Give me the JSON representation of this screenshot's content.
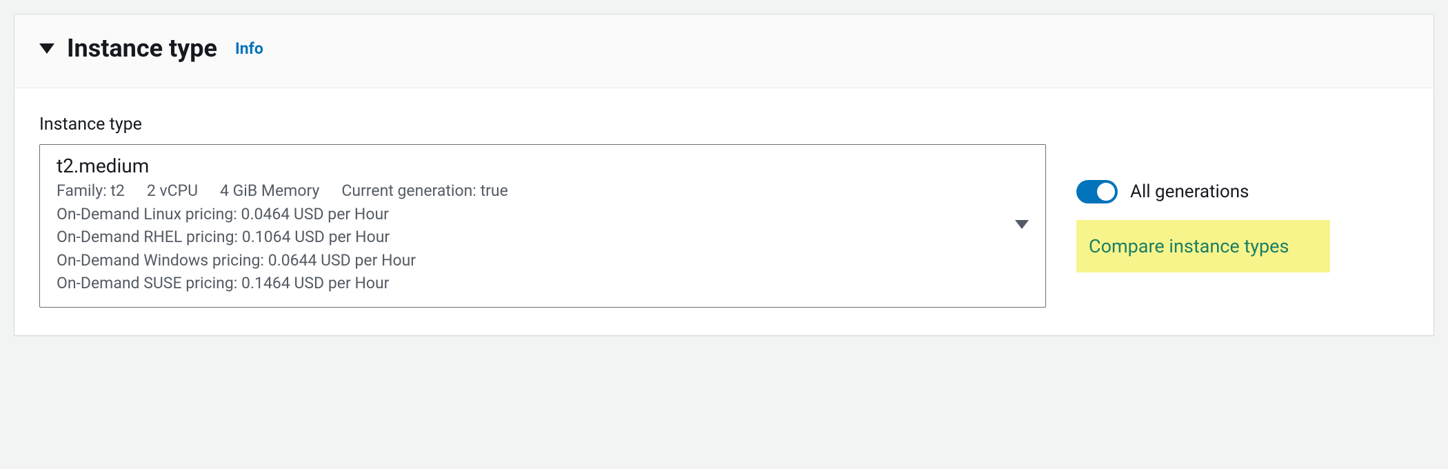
{
  "panel": {
    "title": "Instance type",
    "info_label": "Info"
  },
  "field": {
    "label": "Instance type"
  },
  "instance": {
    "name": "t2.medium",
    "specs": {
      "family": "Family: t2",
      "vcpu": "2 vCPU",
      "memory": "4 GiB Memory",
      "generation": "Current generation: true"
    },
    "pricing": {
      "linux": "On-Demand Linux pricing: 0.0464 USD per Hour",
      "rhel": "On-Demand RHEL pricing: 0.1064 USD per Hour",
      "windows": "On-Demand Windows pricing: 0.0644 USD per Hour",
      "suse": "On-Demand SUSE pricing: 0.1464 USD per Hour"
    }
  },
  "controls": {
    "all_generations_label": "All generations",
    "all_generations_on": true,
    "compare_label": "Compare instance types"
  }
}
